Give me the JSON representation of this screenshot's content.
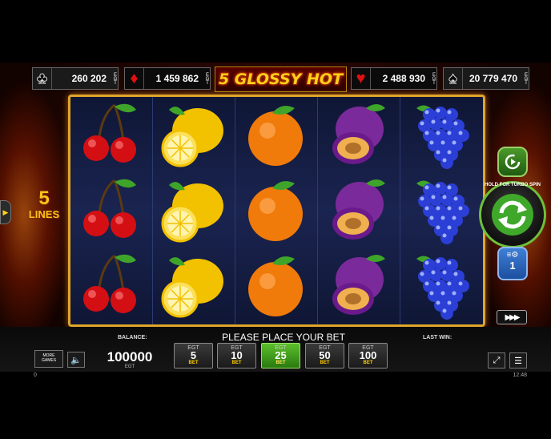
{
  "game": {
    "title": "5 GLOSSY HOT"
  },
  "jackpots": [
    {
      "suit": "clubs",
      "symbol": "♣",
      "amount": "260 202",
      "currency": "EGT"
    },
    {
      "suit": "diamonds",
      "symbol": "♦",
      "amount": "1 459 862",
      "currency": "EGT"
    },
    {
      "suit": "hearts",
      "symbol": "♥",
      "amount": "2 488 930",
      "currency": "EGT"
    },
    {
      "suit": "spades",
      "symbol": "♠",
      "amount": "20 779 470",
      "currency": "EGT"
    }
  ],
  "lines": {
    "count": "5",
    "label": "LINES"
  },
  "reels": [
    [
      "cherry",
      "cherry",
      "cherry"
    ],
    [
      "lemon",
      "lemon",
      "lemon"
    ],
    [
      "orange",
      "orange",
      "orange"
    ],
    [
      "plum",
      "plum",
      "plum"
    ],
    [
      "grapes",
      "grapes",
      "grapes"
    ]
  ],
  "controls": {
    "hold_for_turbo_label": "HOLD FOR TURBO SPIN",
    "turbo_value": "1",
    "fast_forward": "▶▶▶"
  },
  "bottom": {
    "balance_label": "BALANCE:",
    "balance_value": "100000",
    "balance_currency": "EGT",
    "message": "PLEASE PLACE YOUR BET",
    "last_win_label": "LAST WIN:",
    "more_games": "MORE GAMES"
  },
  "bets": [
    {
      "currency": "EGT",
      "value": "5",
      "label": "BET",
      "active": false
    },
    {
      "currency": "EGT",
      "value": "10",
      "label": "BET",
      "active": false
    },
    {
      "currency": "EGT",
      "value": "25",
      "label": "BET",
      "active": true
    },
    {
      "currency": "EGT",
      "value": "50",
      "label": "BET",
      "active": false
    },
    {
      "currency": "EGT",
      "value": "100",
      "label": "BET",
      "active": false
    }
  ],
  "status": {
    "left": "0",
    "time": "12:48"
  },
  "colors": {
    "frame_gold": "#e0a52a",
    "accent_green": "#5bbf2a",
    "jackpot_yellow": "#ffd21a"
  }
}
